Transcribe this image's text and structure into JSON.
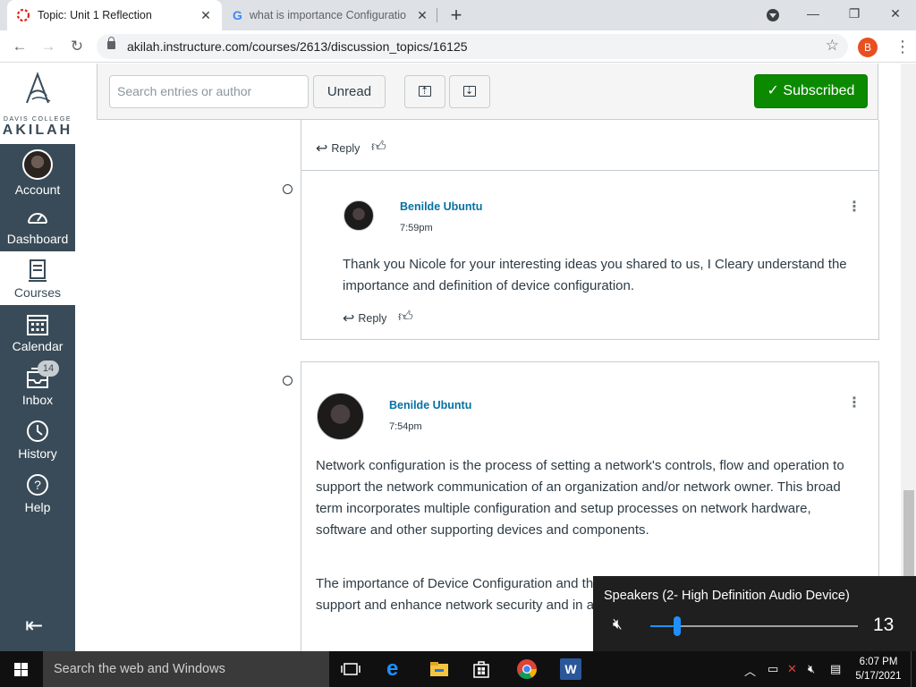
{
  "browser": {
    "tabs": [
      {
        "title": "Topic: Unit 1 Reflection",
        "active": true
      },
      {
        "title": "what is importance Configuratio",
        "active": false
      }
    ],
    "url": "akilah.instructure.com/courses/2613/discussion_topics/16125",
    "profile_initial": "B"
  },
  "school": {
    "college": "DAVIS COLLEGE",
    "name": "AKILAH"
  },
  "global_nav": {
    "items": [
      {
        "label": "Account",
        "icon": "avatar-icon"
      },
      {
        "label": "Dashboard",
        "icon": "dashboard-icon"
      },
      {
        "label": "Courses",
        "icon": "courses-icon",
        "active": true
      },
      {
        "label": "Calendar",
        "icon": "calendar-icon"
      },
      {
        "label": "Inbox",
        "icon": "inbox-icon",
        "badge": "14"
      },
      {
        "label": "History",
        "icon": "history-icon"
      },
      {
        "label": "Help",
        "icon": "help-icon"
      }
    ]
  },
  "discussion_toolbar": {
    "search_placeholder": "Search entries or author",
    "unread_label": "Unread",
    "subscribed_label": "Subscribed",
    "subscribed_color": "#0b8a00"
  },
  "entries": [
    {
      "reply_label": "Reply"
    },
    {
      "author": "Benilde Ubuntu",
      "time": "7:59pm",
      "body": "Thank you Nicole for your interesting ideas you shared to us, I Cleary understand the importance and definition of device configuration.",
      "reply_label": "Reply"
    },
    {
      "author": "Benilde Ubuntu",
      "time": "7:54pm",
      "body1": "Network configuration is the process of setting a network's controls, flow and operation to support the network communication of an organization and/or network owner. This broad term incorporates multiple configuration and setup processes on network hardware, software and other supporting devices and components.",
      "body2": "The importance of Device Configuration and the right essential that is to support the flow of t support and enhance network security and in are another reason why configuration manag"
    }
  ],
  "volume_flyout": {
    "device": "Speakers (2- High Definition Audio Device)",
    "level": 13,
    "level_fraction": 0.13,
    "accent": "#1e90ff"
  },
  "taskbar": {
    "search_placeholder": "Search the web and Windows",
    "time": "6:07 PM",
    "date": "5/17/2021"
  }
}
